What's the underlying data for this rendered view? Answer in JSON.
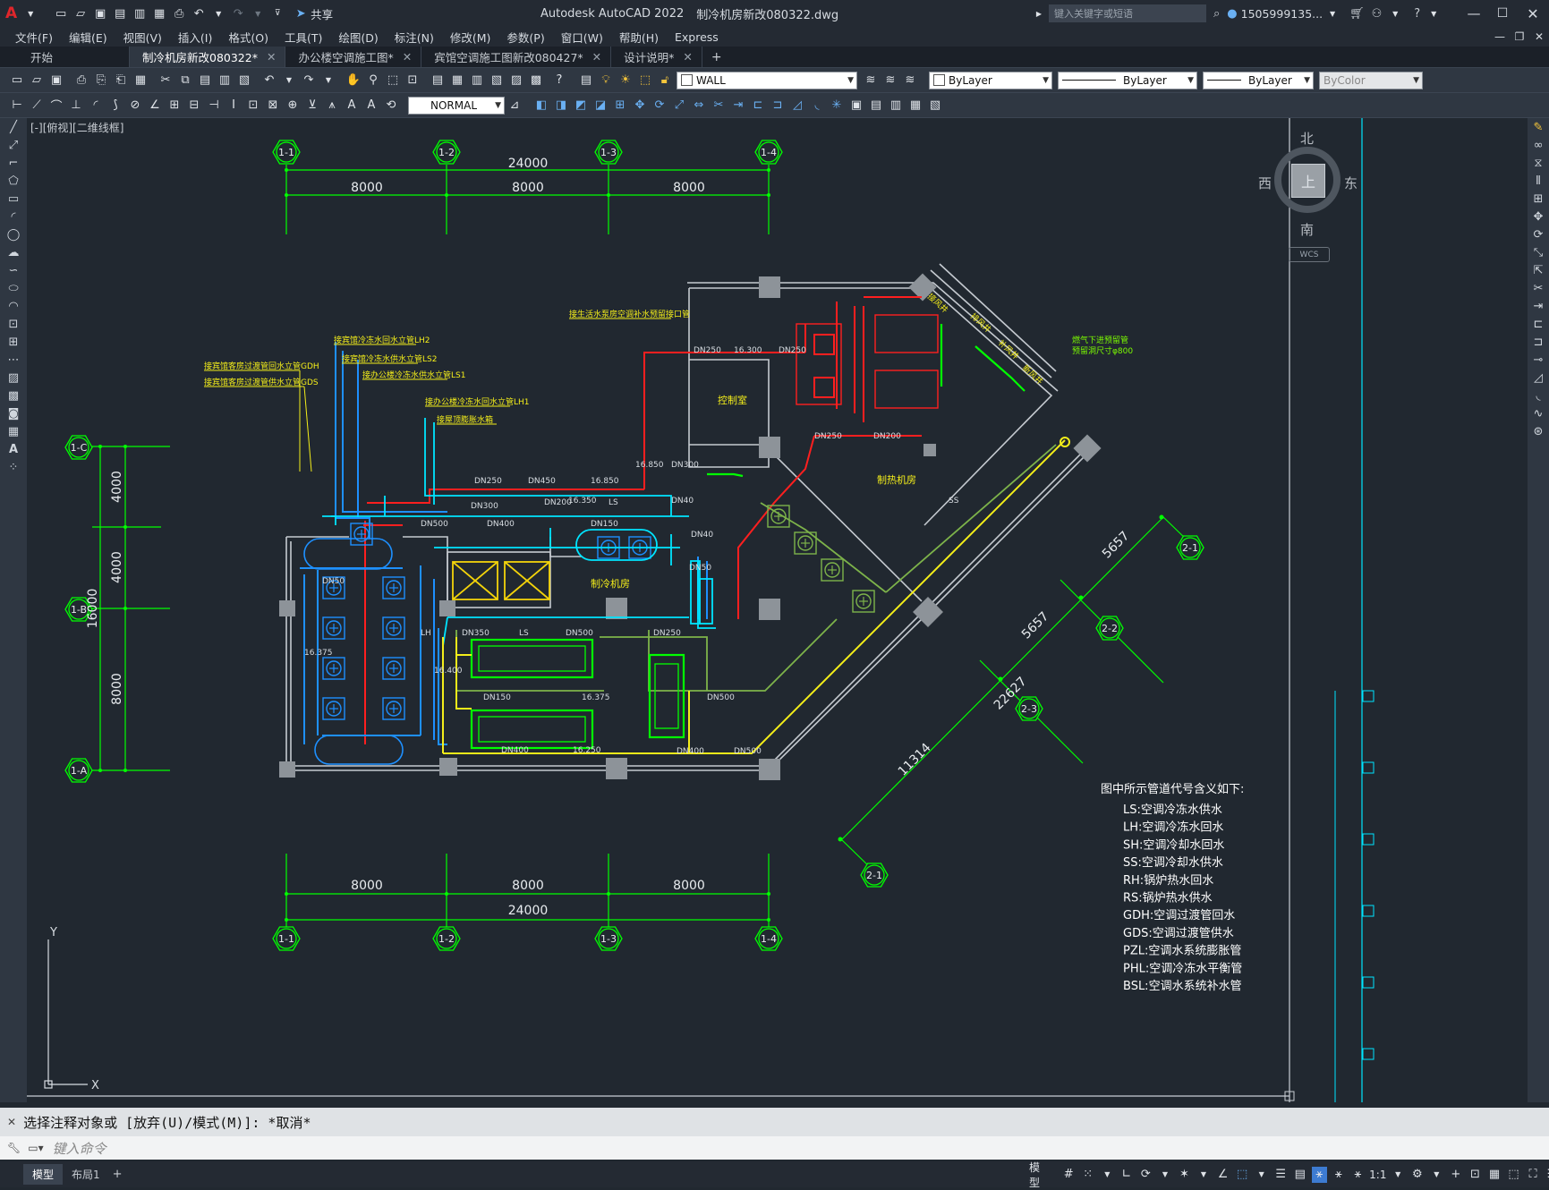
{
  "titlebar": {
    "app_title": "Autodesk AutoCAD 2022",
    "file_name": "制冷机房新改080322.dwg",
    "share_label": "共享",
    "search_placeholder": "键入关键字或短语",
    "user_name": "1505999135..."
  },
  "menubar": {
    "items": [
      "文件(F)",
      "编辑(E)",
      "视图(V)",
      "插入(I)",
      "格式(O)",
      "工具(T)",
      "绘图(D)",
      "标注(N)",
      "修改(M)",
      "参数(P)",
      "窗口(W)",
      "帮助(H)",
      "Express"
    ]
  },
  "tabs": [
    "开始",
    "制冷机房新改080322*",
    "办公楼空调施工图*",
    "宾馆空调施工图新改080427*",
    "设计说明*"
  ],
  "toolbar": {
    "layer_name": "WALL",
    "color": "ByLayer",
    "linetype": "ByLayer",
    "lineweight": "ByLayer",
    "plotstyle": "ByColor",
    "dimstyle": "NORMAL"
  },
  "viewport_label": "[-][俯视][二维线框]",
  "viewcube": {
    "north": "北",
    "south": "南",
    "east": "东",
    "west": "西",
    "top": "上",
    "wcs": "WCS"
  },
  "ucs": {
    "x": "X",
    "y": "Y"
  },
  "drawing": {
    "grid_top": [
      "1-1",
      "1-2",
      "1-3",
      "1-4"
    ],
    "grid_left": [
      "1-C",
      "1-B",
      "1-A"
    ],
    "grid_diag": [
      "2-1",
      "2-2",
      "2-3"
    ],
    "dim_top_total": "24000",
    "dim_top": [
      "8000",
      "8000",
      "8000"
    ],
    "dim_bottom": [
      "8000",
      "8000",
      "8000"
    ],
    "dim_bottom_total": "24000",
    "dim_left": [
      "4000",
      "4000",
      "8000"
    ],
    "dim_left_total": "16000",
    "dim_diag": [
      "5657",
      "5657",
      "22627",
      "11314"
    ],
    "rooms": {
      "chiller": "制冷机房",
      "control": "控制室",
      "heating": "制热机房"
    },
    "annotations": [
      "接宾馆客房过渡管回水立管GDH",
      "接宾馆客房过渡管供水立管GDS",
      "接宾馆冷冻水回水立管LH2",
      "接宾馆冷冻水供水立管LS2",
      "接办公楼冷冻水供水立管LS1",
      "接办公楼冷冻水回水立管LH1",
      "接屋顶膨胀水箱",
      "接生活水泵房空调补水预留接口管",
      "接风井",
      "排风井",
      "补风井",
      "新风井",
      "燃气下进预留管",
      "预留洞尺寸φ800"
    ],
    "pipe_labels": [
      "DN250",
      "DN200",
      "DN300",
      "DN400",
      "DN450",
      "DN500",
      "DN150",
      "DN350",
      "DN40",
      "DN50",
      "16.850",
      "16.300",
      "16.350",
      "16.250",
      "16.375",
      "16.400",
      "GDH",
      "GDS",
      "LH",
      "LS",
      "SH",
      "SS",
      "PHL",
      "PZL",
      "RS",
      "RH"
    ],
    "legend_title": "图中所示管道代号含义如下:",
    "legend": [
      "LS:空调冷冻水供水",
      "LH:空调冷冻水回水",
      "SH:空调冷却水回水",
      "SS:空调冷却水供水",
      "RH:锅炉热水回水",
      "RS:锅炉热水供水",
      "GDH:空调过渡管回水",
      "GDS:空调过渡管供水",
      "PZL:空调水系统膨胀管",
      "PHL:空调冷冻水平衡管",
      "BSL:空调水系统补水管"
    ]
  },
  "command": {
    "history": "选择注释对象或 [放弃(U)/模式(M)]: *取消*",
    "input_placeholder": "键入命令"
  },
  "status": {
    "layout_tabs": [
      "模型",
      "布局1"
    ],
    "model_label": "模型",
    "scale": "1:1"
  }
}
